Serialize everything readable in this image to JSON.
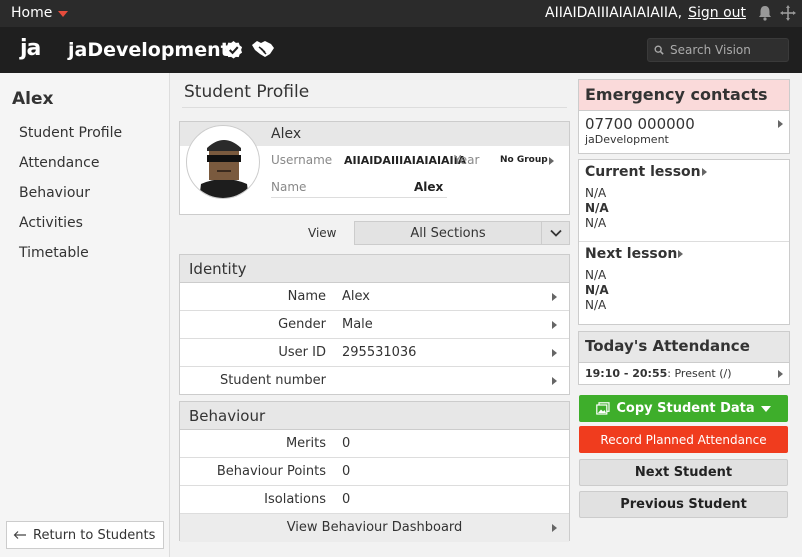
{
  "topbar": {
    "home_label": "Home",
    "username": "AIIAIDAIIIAIAIAIAIIA,",
    "signout_label": "Sign out"
  },
  "appbar": {
    "logo": "ja",
    "title": "jaDevelopment"
  },
  "search": {
    "placeholder": "Search Vision"
  },
  "sidebar": {
    "student_name": "Alex",
    "items": [
      {
        "label": "Student Profile"
      },
      {
        "label": "Attendance"
      },
      {
        "label": "Behaviour"
      },
      {
        "label": "Activities"
      },
      {
        "label": "Timetable"
      }
    ],
    "back_label": "Return to Students"
  },
  "main": {
    "title": "Student Profile",
    "profile": {
      "name": "Alex",
      "username_label": "Username",
      "username_value": "AIIAIDAIIIAIAIAIAIIA",
      "year_label": "Year",
      "year_value": "No Group",
      "name_label": "Name",
      "name_value": "Alex"
    },
    "view": {
      "label": "View",
      "selected": "All Sections"
    },
    "identity": {
      "heading": "Identity",
      "rows": [
        {
          "key": "Name",
          "value": "Alex"
        },
        {
          "key": "Gender",
          "value": "Male"
        },
        {
          "key": "User ID",
          "value": "295531036"
        },
        {
          "key": "Student number",
          "value": ""
        }
      ]
    },
    "behaviour": {
      "heading": "Behaviour",
      "rows": [
        {
          "key": "Merits",
          "value": "0"
        },
        {
          "key": "Behaviour Points",
          "value": "0"
        },
        {
          "key": "Isolations",
          "value": "0"
        }
      ],
      "dashboard_link": "View Behaviour Dashboard"
    }
  },
  "right": {
    "emergency": {
      "heading": "Emergency contacts",
      "phone": "07700 000000",
      "org": "jaDevelopment"
    },
    "current_lesson": {
      "heading": "Current lesson",
      "l1": "N/A",
      "l2": "N/A",
      "l3": "N/A"
    },
    "next_lesson": {
      "heading": "Next lesson",
      "l1": "N/A",
      "l2": "N/A",
      "l3": "N/A"
    },
    "attendance": {
      "heading": "Today's Attendance",
      "time": "19:10 - 20:55",
      "status": ": Present (/)"
    },
    "buttons": {
      "copy": "Copy Student Data",
      "record": "Record Planned Attendance",
      "next": "Next Student",
      "previous": "Previous Student"
    }
  },
  "colors": {
    "accent_green": "#3eae2b",
    "accent_red": "#f03c1e",
    "emergency_bg": "#fadada",
    "topbar_bg": "#2b2b2b"
  }
}
